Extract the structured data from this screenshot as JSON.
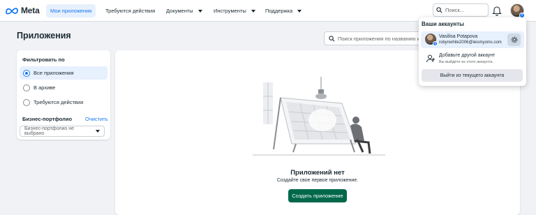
{
  "brand": {
    "name": "Meta",
    "accent": "#1877f2",
    "primary_button": "#00684a"
  },
  "nav": {
    "items": [
      {
        "label": "Мои приложения",
        "active": true,
        "dropdown": false
      },
      {
        "label": "Требуются действия",
        "active": false,
        "dropdown": false
      },
      {
        "label": "Документы",
        "active": false,
        "dropdown": true
      },
      {
        "label": "Инструменты",
        "active": false,
        "dropdown": true
      },
      {
        "label": "Поддержка",
        "active": false,
        "dropdown": true
      }
    ],
    "search_placeholder": "Поиск...",
    "icons": {
      "search": "search-icon",
      "notifications": "bell-icon",
      "avatar": "avatar"
    }
  },
  "page": {
    "title": "Приложения",
    "search_placeholder": "Поиск приложения по названию или ID"
  },
  "filter": {
    "heading": "Фильтровать по",
    "options": [
      {
        "label": "Все приложения",
        "selected": true
      },
      {
        "label": "В архиве",
        "selected": false
      },
      {
        "label": "Требуются действия",
        "selected": false
      }
    ],
    "business": {
      "label": "Бизнес-портфолио",
      "clear": "Очистить",
      "select_value": "Бизнес-портфолио не выбрано"
    }
  },
  "empty_state": {
    "title": "Приложений нет",
    "subtitle": "Создайте свое первое приложение.",
    "button": "Создать приложение"
  },
  "accounts": {
    "title": "Ваши аккаунты",
    "current": {
      "name": "Vasilisa Potapova",
      "email": "robynwhite2006@leismyoms.com"
    },
    "add": {
      "title": "Добавьте другой аккаунт",
      "subtitle": "Вы выйдете из этого аккаунта."
    },
    "logout": "Выйти из текущего аккаунта"
  }
}
